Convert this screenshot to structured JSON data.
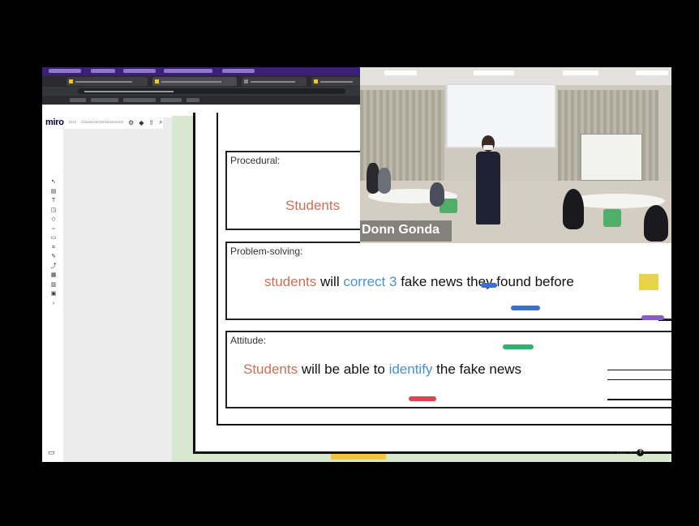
{
  "board": {
    "procedural": {
      "label": "Procedural:",
      "text": "Students"
    },
    "problem_solving": {
      "label": "Problem-solving:",
      "w1": "students",
      "w2": " will ",
      "w3": "correct 3",
      "w4": " fake news they found before"
    },
    "attitude": {
      "label": "Attitude:",
      "w1": "Students",
      "w2": " will be able to ",
      "w3": "identify",
      "w4": " the fake news"
    }
  },
  "video": {
    "speaker_name": "Donn Gonda"
  },
  "toolbar": {
    "logo": "miro"
  },
  "colors": {
    "orange_text": "#c8715a",
    "blue_text": "#4a90d0",
    "board_bg": "#d7e7d0",
    "tag_blue": "#3b6fd1",
    "tag_green": "#2fb36b",
    "tag_red": "#e04454",
    "tag_purple": "#8a5cc9"
  },
  "icons": [
    "cursor-icon",
    "sticky-note-icon",
    "text-icon",
    "shape-icon",
    "pen-icon",
    "comment-icon",
    "frame-icon",
    "zoom-out-icon",
    "zoom-in-icon",
    "help-icon"
  ]
}
